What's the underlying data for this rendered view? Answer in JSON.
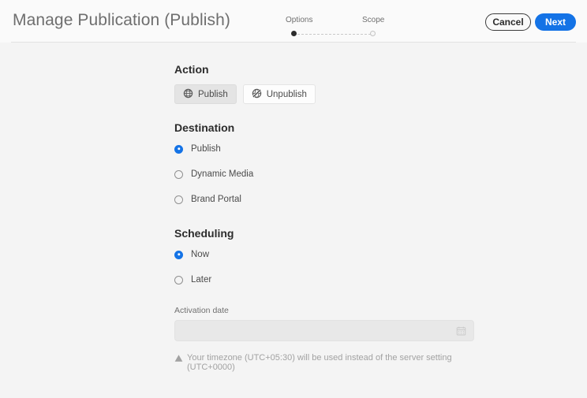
{
  "header": {
    "title": "Manage Publication (Publish)",
    "steps": [
      {
        "label": "Options",
        "state": "active"
      },
      {
        "label": "Scope",
        "state": "inactive"
      }
    ],
    "cancel_label": "Cancel",
    "next_label": "Next",
    "accent_color": "#1473e6"
  },
  "form": {
    "action": {
      "title": "Action",
      "options": [
        {
          "label": "Publish",
          "icon": "globe-icon",
          "selected": true
        },
        {
          "label": "Unpublish",
          "icon": "globe-slash-icon",
          "selected": false
        }
      ]
    },
    "destination": {
      "title": "Destination",
      "options": [
        {
          "label": "Publish",
          "selected": true
        },
        {
          "label": "Dynamic Media",
          "selected": false
        },
        {
          "label": "Brand Portal",
          "selected": false
        }
      ]
    },
    "scheduling": {
      "title": "Scheduling",
      "options": [
        {
          "label": "Now",
          "selected": true
        },
        {
          "label": "Later",
          "selected": false
        }
      ],
      "activation_date": {
        "label": "Activation date",
        "value": "",
        "placeholder": "",
        "disabled": true,
        "icon": "calendar-icon"
      },
      "warning": {
        "icon": "warning-triangle-icon",
        "text": "Your timezone (UTC+05:30) will be used instead of the server setting (UTC+0000)"
      }
    }
  }
}
